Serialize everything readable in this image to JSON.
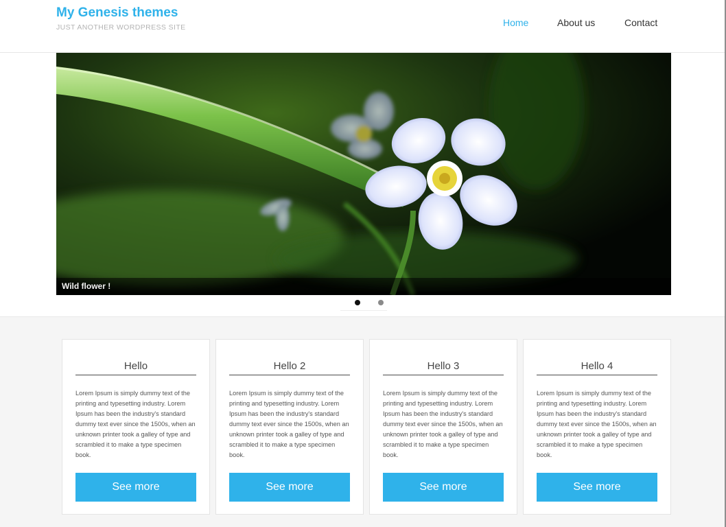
{
  "header": {
    "site_title": "My Genesis themes",
    "site_description": "JUST ANOTHER WORDPRESS SITE",
    "nav": [
      {
        "label": "Home",
        "active": true
      },
      {
        "label": "About us",
        "active": false
      },
      {
        "label": "Contact",
        "active": false
      }
    ],
    "accent_color": "#2fb2ea"
  },
  "slider": {
    "caption": "Wild flower !",
    "slide_image": "flower-photo",
    "slide_count": 2,
    "active_slide": 1
  },
  "cards": [
    {
      "title": "Hello",
      "text": "Lorem Ipsum is simply dummy text of the printing and typesetting industry. Lorem Ipsum has been the industry's standard dummy text ever since the 1500s, when an unknown printer took a galley of type and scrambled it to make a type specimen book.",
      "button_label": "See more"
    },
    {
      "title": "Hello 2",
      "text": "Lorem Ipsum is simply dummy text of the printing and typesetting industry. Lorem Ipsum has been the industry's standard dummy text ever since the 1500s, when an unknown printer took a galley of type and scrambled it to make a type specimen book.",
      "button_label": "See more"
    },
    {
      "title": "Hello 3",
      "text": "Lorem Ipsum is simply dummy text of the printing and typesetting industry. Lorem Ipsum has been the industry's standard dummy text ever since the 1500s, when an unknown printer took a galley of type and scrambled it to make a type specimen book.",
      "button_label": "See more"
    },
    {
      "title": "Hello 4",
      "text": "Lorem Ipsum is simply dummy text of the printing and typesetting industry. Lorem Ipsum has been the industry's standard dummy text ever since the 1500s, when an unknown printer took a galley of type and scrambled it to make a type specimen book.",
      "button_label": "See more"
    }
  ]
}
